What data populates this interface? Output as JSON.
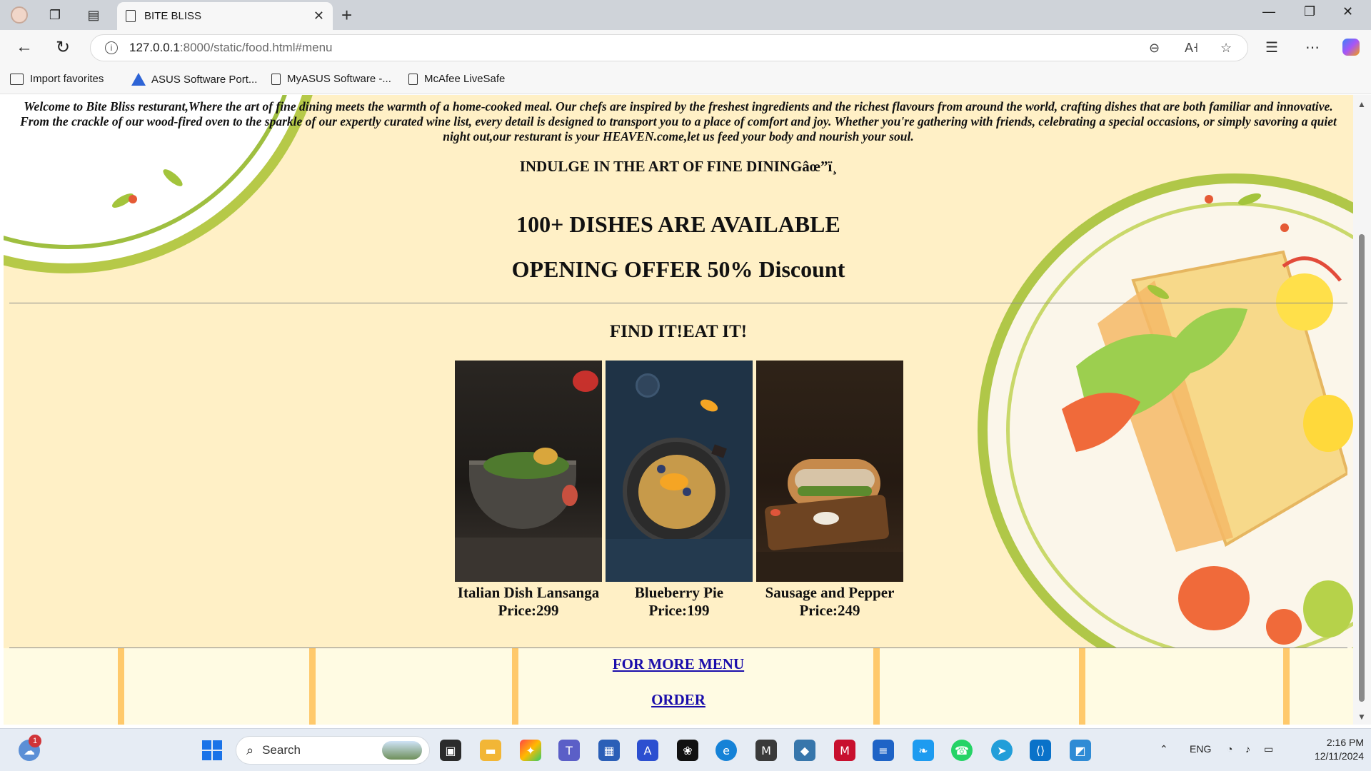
{
  "browser": {
    "tab_title": "BITE BLISS",
    "url_host": "127.0.0.1",
    "url_path": ":8000/static/food.html#menu",
    "favorites": [
      {
        "label": "Import favorites",
        "icon": "import-icon"
      },
      {
        "label": "ASUS Software Port...",
        "icon": "asus-icon"
      },
      {
        "label": "MyASUS Software -...",
        "icon": "page-icon"
      },
      {
        "label": "McAfee LiveSafe",
        "icon": "page-icon"
      }
    ]
  },
  "page": {
    "welcome": "Welcome to Bite Bliss resturant,Where the art of fine dining meets the warmth of a home-cooked meal. Our chefs are inspired by the freshest ingredients and the richest flavours from around the world, crafting dishes that are both familiar and innovative. From the crackle of our wood-fired oven to the sparkle of our expertly curated wine list, every detail is designed to transport you to a place of comfort and joy. Whether you're gathering with friends, celebrating a special occasions, or simply savoring a quiet night out,our resturant is your HEAVEN.come,let us feed your body and nourish your soul.",
    "indulge": "INDULGE IN THE ART OF FINE DININGâœ”ï¸",
    "dishes_available": "100+ DISHES ARE AVAILABLE",
    "offer": "OPENING OFFER 50% Discount",
    "find": "FIND IT!EAT IT!",
    "menu_items": [
      {
        "name": "Italian Dish Lansanga",
        "price": "Price:299"
      },
      {
        "name": "Blueberry Pie",
        "price": "Price:199"
      },
      {
        "name": "Sausage and Pepper",
        "price": "Price:249"
      }
    ],
    "more_menu_link": "FOR MORE MENU",
    "order_link": "ORDER",
    "colors": {
      "background": "#fff0c6",
      "link": "#1a0dab",
      "plate_rim": "#b0c748"
    }
  },
  "taskbar": {
    "search_placeholder": "Search",
    "weather_badge": "1",
    "language": "ENG",
    "time": "2:16 PM",
    "date": "12/11/2024"
  }
}
